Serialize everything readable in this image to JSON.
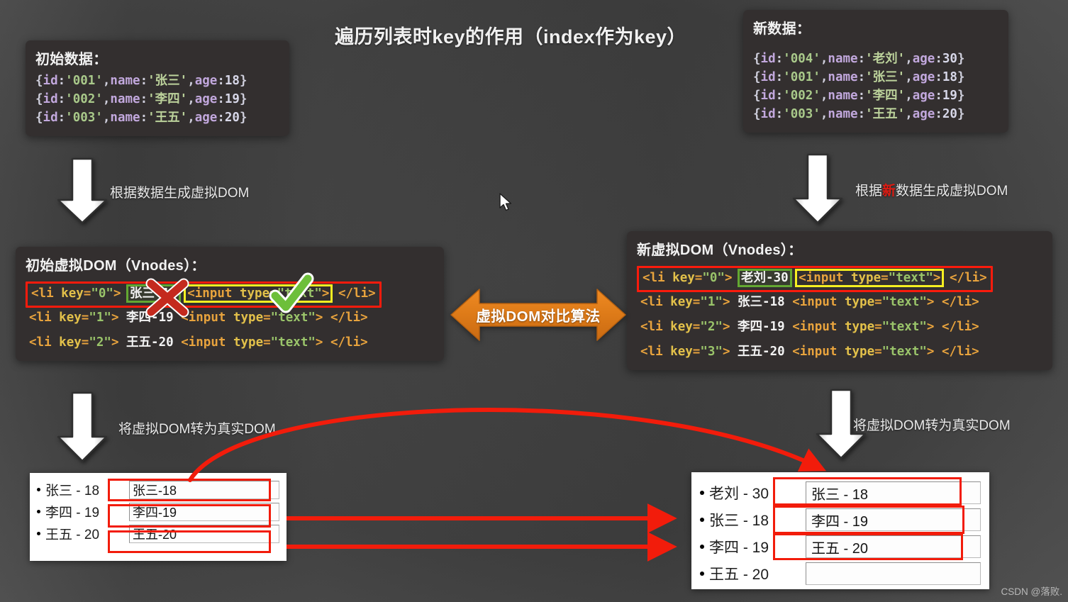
{
  "title": "遍历列表时key的作用（index作为key）",
  "watermark": "CSDN @落败.",
  "colors": {
    "background": "#414141",
    "panel": "#332f2f",
    "accent_orange": "#e07b1f",
    "highlight_red": "#fb1b0c",
    "highlight_green": "#63a832",
    "highlight_yellow": "#f6ef21",
    "arrow_red": "#f21c0b"
  },
  "panels": {
    "initial_data": {
      "title": "初始数据：",
      "lines": [
        {
          "id": "'001'",
          "name": "'张三'",
          "age": "18"
        },
        {
          "id": "'002'",
          "name": "'李四'",
          "age": "19"
        },
        {
          "id": "'003'",
          "name": "'王五'",
          "age": "20"
        }
      ]
    },
    "new_data": {
      "title": "新数据：",
      "lines": [
        {
          "id": "'004'",
          "name": "'老刘'",
          "age": "30"
        },
        {
          "id": "'001'",
          "name": "'张三'",
          "age": "18"
        },
        {
          "id": "'002'",
          "name": "'李四'",
          "age": "19"
        },
        {
          "id": "'003'",
          "name": "'王五'",
          "age": "20"
        }
      ]
    },
    "initial_vdom": {
      "title": "初始虚拟DOM（Vnodes）：",
      "rows": [
        {
          "key": "\"0\"",
          "text": "张三-18",
          "input": "<input type=\"text\">",
          "highlighted": true
        },
        {
          "key": "\"1\"",
          "text": "李四-19",
          "input": "<input type=\"text\">",
          "highlighted": false
        },
        {
          "key": "\"2\"",
          "text": "王五-20",
          "input": "<input type=\"text\">",
          "highlighted": false
        }
      ]
    },
    "new_vdom": {
      "title": "新虚拟DOM（Vnodes）：",
      "rows": [
        {
          "key": "\"0\"",
          "text": "老刘-30",
          "input": "<input type=\"text\">",
          "highlighted": true
        },
        {
          "key": "\"1\"",
          "text": "张三-18",
          "input": "<input type=\"text\">",
          "highlighted": false
        },
        {
          "key": "\"2\"",
          "text": "李四-19",
          "input": "<input type=\"text\">",
          "highlighted": false
        },
        {
          "key": "\"3\"",
          "text": "王五-20",
          "input": "<input type=\"text\">",
          "highlighted": false
        }
      ]
    }
  },
  "labels": {
    "left_gen_vdom": "根据数据生成虚拟DOM",
    "right_gen_vdom_pre": "根据",
    "right_gen_vdom_hl": "新",
    "right_gen_vdom_post": "数据生成虚拟DOM",
    "left_to_realdom": "将虚拟DOM转为真实DOM",
    "right_to_realdom": "将虚拟DOM转为真实DOM",
    "diff_algorithm": "虚拟DOM对比算法"
  },
  "realdom_left": {
    "rows": [
      {
        "label": "张三 - 18",
        "input": "张三-18"
      },
      {
        "label": "李四 - 19",
        "input": "李四-19"
      },
      {
        "label": "王五 - 20",
        "input": "王五-20"
      }
    ]
  },
  "realdom_right": {
    "rows": [
      {
        "label": "老刘 - 30",
        "input": "张三 - 18"
      },
      {
        "label": "张三 - 18",
        "input": "李四 - 19"
      },
      {
        "label": "李四 - 19",
        "input": "王五 - 20"
      },
      {
        "label": "王五 - 20",
        "input": ""
      }
    ]
  },
  "marks": {
    "cross": "red-x-mark",
    "check": "green-check-mark"
  }
}
